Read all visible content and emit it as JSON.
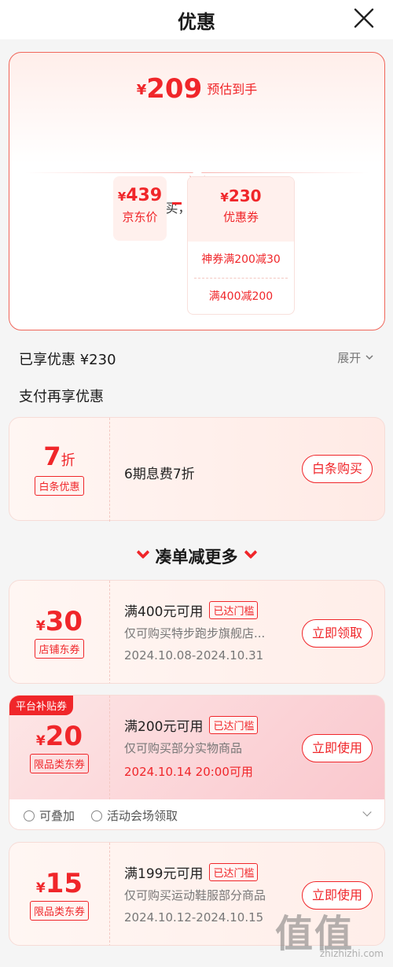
{
  "header": {
    "title": "优惠"
  },
  "summary": {
    "currency": "¥",
    "estimate": "209",
    "estimate_label": "预估到手",
    "subtitle": "现在购买，享受以下优惠",
    "jd_price_value": "439",
    "jd_price_label": "京东价",
    "coupon_value": "230",
    "coupon_label": "优惠券",
    "coupon_items": [
      "神券满200减30",
      "满400减200"
    ]
  },
  "enjoyed": {
    "label": "已享优惠 ¥230",
    "expand": "展开"
  },
  "pay": {
    "title": "支付再享优惠",
    "discount": "7",
    "discount_unit": "折",
    "tag": "白条优惠",
    "desc": "6期息费7折",
    "button": "白条购买"
  },
  "more": {
    "title": "凑单减更多"
  },
  "coupons": [
    {
      "currency": "¥",
      "amount": "30",
      "tag": "店铺东券",
      "condition": "满400元可用",
      "badge": "已达门槛",
      "scope": "仅可购买特步跑步旗舰店...",
      "date": "2024.10.08-2024.10.31",
      "button": "立即领取"
    },
    {
      "ribbon": "平台补贴券",
      "currency": "¥",
      "amount": "20",
      "tag": "限品类东券",
      "condition": "满200元可用",
      "badge": "已达门槛",
      "scope": "仅可购买部分实物商品",
      "date": "2024.10.14 20:00可用",
      "button": "立即使用",
      "foot_stackable": "可叠加",
      "foot_source": "活动会场领取"
    },
    {
      "currency": "¥",
      "amount": "15",
      "tag": "限品类东券",
      "condition": "满199元可用",
      "badge": "已达门槛",
      "scope": "仅可购买运动鞋服部分商品",
      "date": "2024.10.12-2024.10.15",
      "button": "立即使用"
    }
  ],
  "watermark": {
    "text": "值值值",
    "url": "zhizhizhi.com"
  }
}
